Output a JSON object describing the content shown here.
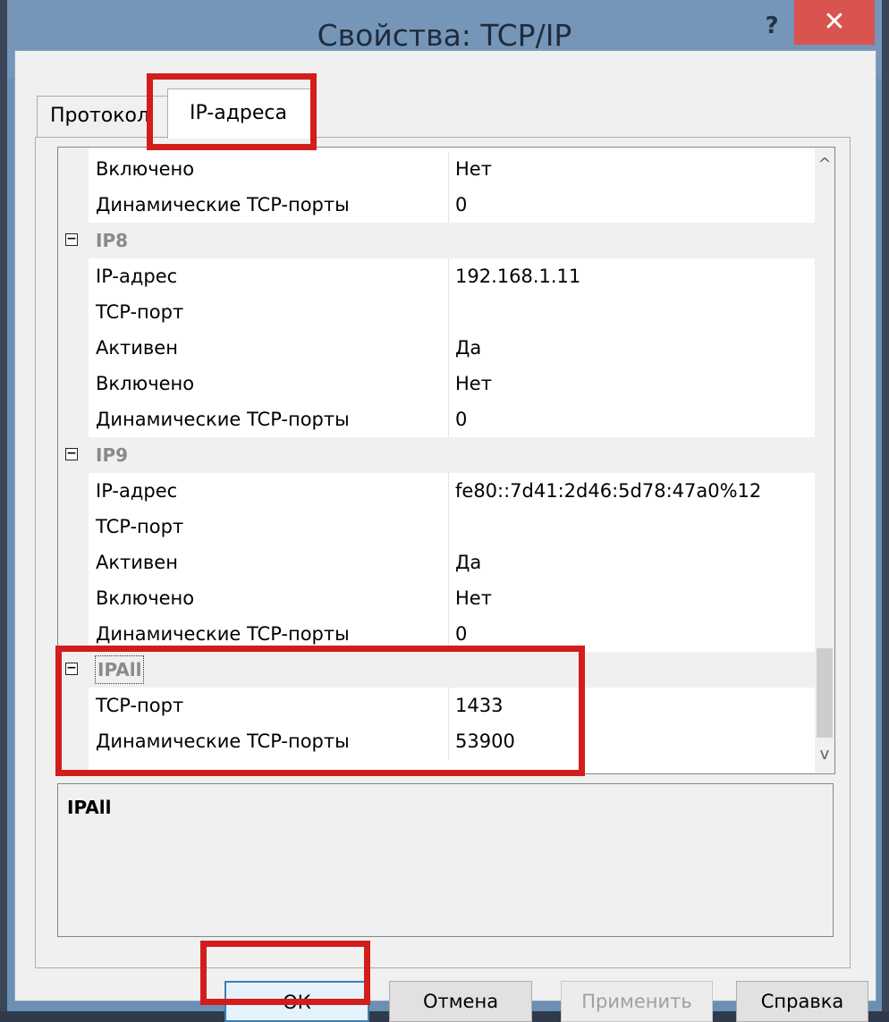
{
  "window": {
    "title": "Свойства: TCP/IP",
    "help_glyph": "?",
    "close_glyph": "✕"
  },
  "tabs": [
    {
      "label": "Протокол"
    },
    {
      "label": "IP-адреса"
    }
  ],
  "grid": {
    "rows": [
      {
        "kind": "prop",
        "name": "Включено",
        "value": "Нет"
      },
      {
        "kind": "prop",
        "name": "Динамические TCP-порты",
        "value": "0"
      },
      {
        "kind": "cat",
        "name": "IP8",
        "toggle": "−"
      },
      {
        "kind": "prop",
        "name": "IP-адрес",
        "value": "192.168.1.11"
      },
      {
        "kind": "prop",
        "name": "TCP-порт",
        "value": ""
      },
      {
        "kind": "prop",
        "name": "Активен",
        "value": "Да"
      },
      {
        "kind": "prop",
        "name": "Включено",
        "value": "Нет"
      },
      {
        "kind": "prop",
        "name": "Динамические TCP-порты",
        "value": "0"
      },
      {
        "kind": "cat",
        "name": "IP9",
        "toggle": "−"
      },
      {
        "kind": "prop",
        "name": "IP-адрес",
        "value": "fe80::7d41:2d46:5d78:47a0%12"
      },
      {
        "kind": "prop",
        "name": "TCP-порт",
        "value": ""
      },
      {
        "kind": "prop",
        "name": "Активен",
        "value": "Да"
      },
      {
        "kind": "prop",
        "name": "Включено",
        "value": "Нет"
      },
      {
        "kind": "prop",
        "name": "Динамические TCP-порты",
        "value": "0"
      },
      {
        "kind": "cat",
        "name": "IPAll",
        "toggle": "−"
      },
      {
        "kind": "prop",
        "name": "TCP-порт",
        "value": "1433"
      },
      {
        "kind": "prop",
        "name": "Динамические TCP-порты",
        "value": "53900"
      }
    ],
    "scroll_up_glyph": "^",
    "scroll_down_glyph": "v"
  },
  "description": {
    "title": "IPAll"
  },
  "buttons": {
    "ok": "ОК",
    "cancel": "Отмена",
    "apply": "Применить",
    "help": "Справка"
  },
  "colors": {
    "highlight": "#d21d1d",
    "titlebar": "#7596b9",
    "close": "#d9534f"
  }
}
